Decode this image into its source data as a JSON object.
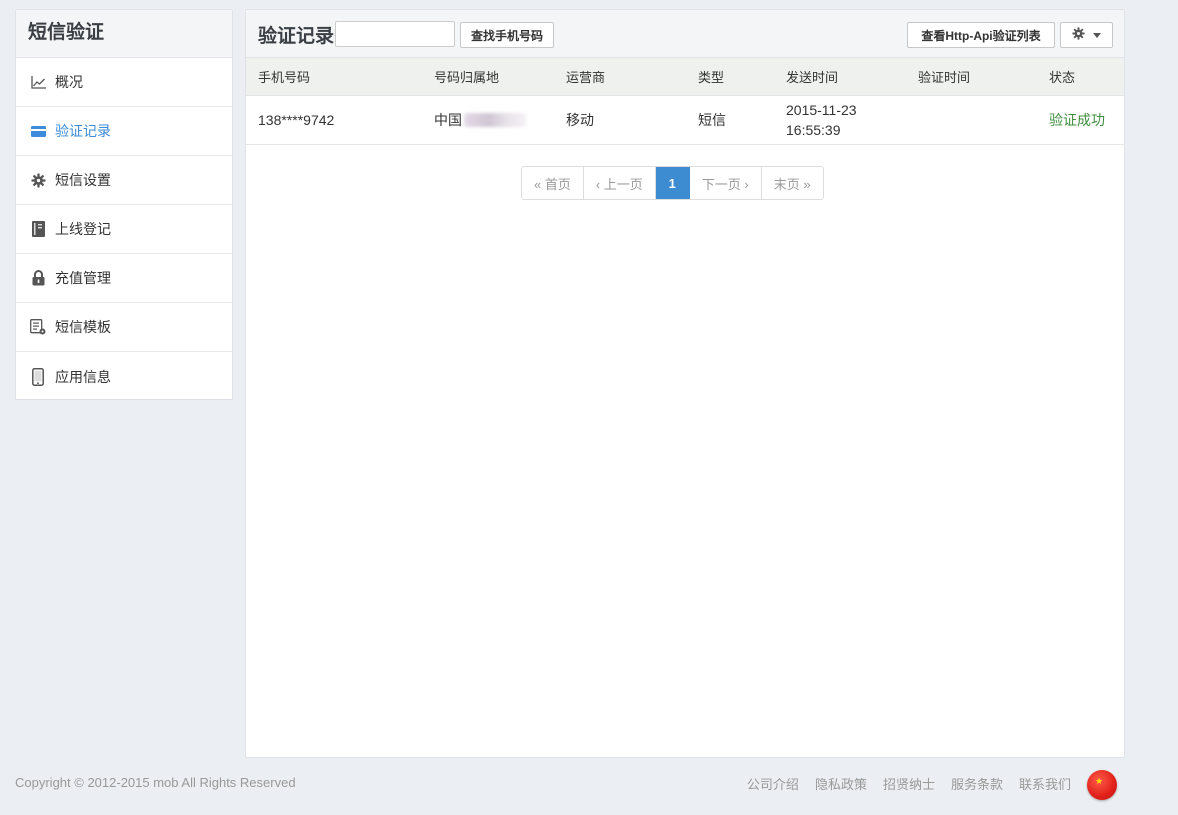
{
  "sidebar": {
    "title": "短信验证",
    "items": [
      {
        "label": "概况",
        "icon": "chart-line-icon",
        "active": false
      },
      {
        "label": "验证记录",
        "icon": "card-icon",
        "active": true
      },
      {
        "label": "短信设置",
        "icon": "gear-icon",
        "active": false
      },
      {
        "label": "上线登记",
        "icon": "book-icon",
        "active": false
      },
      {
        "label": "充值管理",
        "icon": "lock-icon",
        "active": false
      },
      {
        "label": "短信模板",
        "icon": "template-icon",
        "active": false
      },
      {
        "label": "应用信息",
        "icon": "phone-icon",
        "active": false
      }
    ]
  },
  "main": {
    "title": "验证记录",
    "search": {
      "value": "",
      "placeholder": ""
    },
    "find_button": "查找手机号码",
    "http_button": "查看Http-Api验证列表",
    "gear_button_icon": "gear-icon"
  },
  "table": {
    "headers": [
      "手机号码",
      "号码归属地",
      "运营商",
      "类型",
      "发送时间",
      "验证时间",
      "状态"
    ],
    "rows": [
      {
        "phone": "138****9742",
        "location": "中国",
        "carrier": "移动",
        "type": "短信",
        "send_date": "2015-11-23",
        "send_time": "16:55:39",
        "verify_time": "",
        "status": "验证成功"
      }
    ]
  },
  "pagination": {
    "first": "« 首页",
    "prev": "‹ 上一页",
    "current": "1",
    "next": "下一页 ›",
    "last": "末页 »"
  },
  "footer": {
    "copyright": "Copyright © 2012-2015 mob All Rights Reserved",
    "links": [
      "公司介绍",
      "隐私政策",
      "招贤纳士",
      "服务条款",
      "联系我们"
    ],
    "flag_icon": "china-flag-icon"
  },
  "colors": {
    "accent": "#3c8bdc",
    "success": "#3e8f3e",
    "page_bg": "#ebeef2"
  }
}
